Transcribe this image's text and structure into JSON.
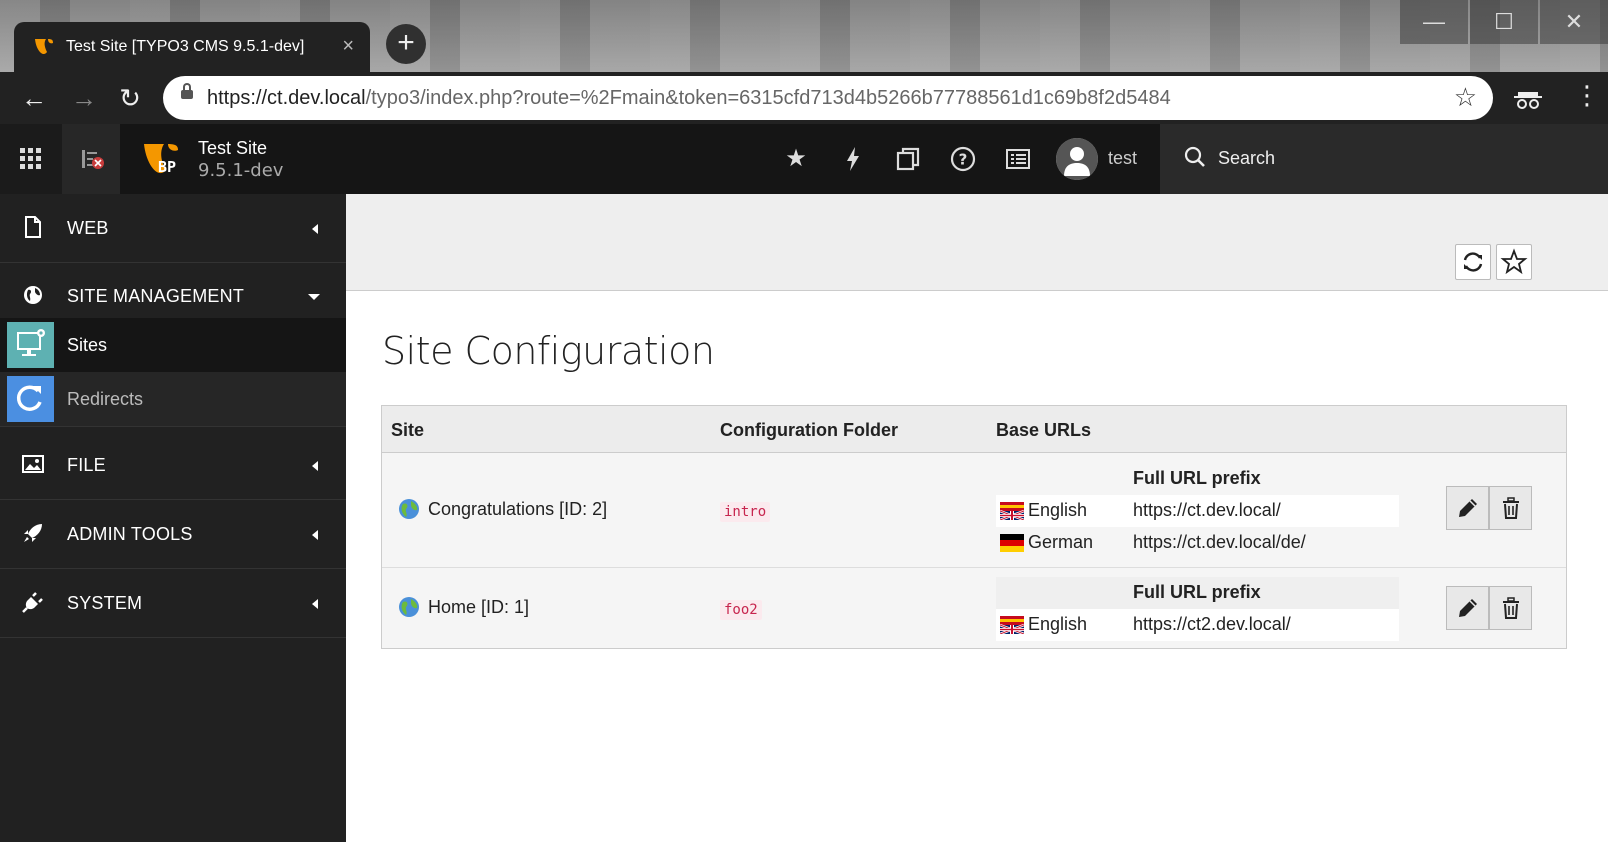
{
  "browser": {
    "tab_title": "Test Site [TYPO3 CMS 9.5.1-dev]",
    "new_tab_label": "+",
    "close_tab_label": "×",
    "url_host": "https://ct.dev.local",
    "url_path": "/typo3/index.php?route=%2Fmain&token=6315cfd713d4b5266b77788561d1c69b8f2d5484",
    "window_controls": [
      "minimize-icon",
      "maximize-icon",
      "close-icon"
    ],
    "nav_icons": [
      "back-arrow-icon",
      "forward-arrow-icon",
      "reload-icon"
    ]
  },
  "topbar": {
    "site_name": "Test Site",
    "site_version": "9.5.1-dev",
    "logo_badge": "BP",
    "icons": [
      "star-icon",
      "flash-icon",
      "copy-icon",
      "help-icon",
      "list-icon"
    ],
    "username": "test",
    "search_label": "Search"
  },
  "sidebar": {
    "groups": [
      {
        "label": "WEB",
        "icon": "page-icon",
        "expanded": false
      },
      {
        "label": "SITE MANAGEMENT",
        "icon": "globe-icon",
        "expanded": true,
        "modules": [
          {
            "label": "Sites",
            "icon": "sites-icon",
            "active": true
          },
          {
            "label": "Redirects",
            "icon": "redirect-icon",
            "active": false
          }
        ]
      },
      {
        "label": "FILE",
        "icon": "image-icon",
        "expanded": false
      },
      {
        "label": "ADMIN TOOLS",
        "icon": "rocket-icon",
        "expanded": false
      },
      {
        "label": "SYSTEM",
        "icon": "plug-icon",
        "expanded": false
      }
    ]
  },
  "docheader": {
    "buttons": [
      "reload-icon",
      "bookmark-star-icon"
    ]
  },
  "main": {
    "title": "Site Configuration",
    "table": {
      "headers": [
        "Site",
        "Configuration Folder",
        "Base URLs"
      ],
      "url_prefix_header": "Full URL prefix",
      "rows": [
        {
          "site": "Congratulations [ID: 2]",
          "folder": "intro",
          "languages": [
            {
              "lang": "English",
              "url": "https://ct.dev.local/",
              "flag": "en-flag"
            },
            {
              "lang": "German",
              "url": "https://ct.dev.local/de/",
              "flag": "de-flag"
            }
          ]
        },
        {
          "site": "Home [ID: 1]",
          "folder": "foo2",
          "languages": [
            {
              "lang": "English",
              "url": "https://ct2.dev.local/",
              "flag": "en-flag"
            }
          ]
        }
      ]
    }
  },
  "colors": {
    "accent_orange": "#f49700",
    "sites_module": "#5eb1b2",
    "redirects_module": "#4b8fe1",
    "code_red": "#c7254e"
  }
}
